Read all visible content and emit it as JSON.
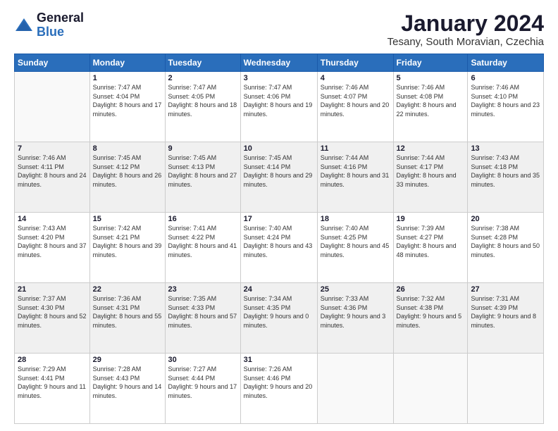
{
  "logo": {
    "general": "General",
    "blue": "Blue"
  },
  "title": "January 2024",
  "location": "Tesany, South Moravian, Czechia",
  "weekdays": [
    "Sunday",
    "Monday",
    "Tuesday",
    "Wednesday",
    "Thursday",
    "Friday",
    "Saturday"
  ],
  "weeks": [
    [
      {
        "day": "",
        "sunrise": "",
        "sunset": "",
        "daylight": ""
      },
      {
        "day": "1",
        "sunrise": "Sunrise: 7:47 AM",
        "sunset": "Sunset: 4:04 PM",
        "daylight": "Daylight: 8 hours and 17 minutes."
      },
      {
        "day": "2",
        "sunrise": "Sunrise: 7:47 AM",
        "sunset": "Sunset: 4:05 PM",
        "daylight": "Daylight: 8 hours and 18 minutes."
      },
      {
        "day": "3",
        "sunrise": "Sunrise: 7:47 AM",
        "sunset": "Sunset: 4:06 PM",
        "daylight": "Daylight: 8 hours and 19 minutes."
      },
      {
        "day": "4",
        "sunrise": "Sunrise: 7:46 AM",
        "sunset": "Sunset: 4:07 PM",
        "daylight": "Daylight: 8 hours and 20 minutes."
      },
      {
        "day": "5",
        "sunrise": "Sunrise: 7:46 AM",
        "sunset": "Sunset: 4:08 PM",
        "daylight": "Daylight: 8 hours and 22 minutes."
      },
      {
        "day": "6",
        "sunrise": "Sunrise: 7:46 AM",
        "sunset": "Sunset: 4:10 PM",
        "daylight": "Daylight: 8 hours and 23 minutes."
      }
    ],
    [
      {
        "day": "7",
        "sunrise": "Sunrise: 7:46 AM",
        "sunset": "Sunset: 4:11 PM",
        "daylight": "Daylight: 8 hours and 24 minutes."
      },
      {
        "day": "8",
        "sunrise": "Sunrise: 7:45 AM",
        "sunset": "Sunset: 4:12 PM",
        "daylight": "Daylight: 8 hours and 26 minutes."
      },
      {
        "day": "9",
        "sunrise": "Sunrise: 7:45 AM",
        "sunset": "Sunset: 4:13 PM",
        "daylight": "Daylight: 8 hours and 27 minutes."
      },
      {
        "day": "10",
        "sunrise": "Sunrise: 7:45 AM",
        "sunset": "Sunset: 4:14 PM",
        "daylight": "Daylight: 8 hours and 29 minutes."
      },
      {
        "day": "11",
        "sunrise": "Sunrise: 7:44 AM",
        "sunset": "Sunset: 4:16 PM",
        "daylight": "Daylight: 8 hours and 31 minutes."
      },
      {
        "day": "12",
        "sunrise": "Sunrise: 7:44 AM",
        "sunset": "Sunset: 4:17 PM",
        "daylight": "Daylight: 8 hours and 33 minutes."
      },
      {
        "day": "13",
        "sunrise": "Sunrise: 7:43 AM",
        "sunset": "Sunset: 4:18 PM",
        "daylight": "Daylight: 8 hours and 35 minutes."
      }
    ],
    [
      {
        "day": "14",
        "sunrise": "Sunrise: 7:43 AM",
        "sunset": "Sunset: 4:20 PM",
        "daylight": "Daylight: 8 hours and 37 minutes."
      },
      {
        "day": "15",
        "sunrise": "Sunrise: 7:42 AM",
        "sunset": "Sunset: 4:21 PM",
        "daylight": "Daylight: 8 hours and 39 minutes."
      },
      {
        "day": "16",
        "sunrise": "Sunrise: 7:41 AM",
        "sunset": "Sunset: 4:22 PM",
        "daylight": "Daylight: 8 hours and 41 minutes."
      },
      {
        "day": "17",
        "sunrise": "Sunrise: 7:40 AM",
        "sunset": "Sunset: 4:24 PM",
        "daylight": "Daylight: 8 hours and 43 minutes."
      },
      {
        "day": "18",
        "sunrise": "Sunrise: 7:40 AM",
        "sunset": "Sunset: 4:25 PM",
        "daylight": "Daylight: 8 hours and 45 minutes."
      },
      {
        "day": "19",
        "sunrise": "Sunrise: 7:39 AM",
        "sunset": "Sunset: 4:27 PM",
        "daylight": "Daylight: 8 hours and 48 minutes."
      },
      {
        "day": "20",
        "sunrise": "Sunrise: 7:38 AM",
        "sunset": "Sunset: 4:28 PM",
        "daylight": "Daylight: 8 hours and 50 minutes."
      }
    ],
    [
      {
        "day": "21",
        "sunrise": "Sunrise: 7:37 AM",
        "sunset": "Sunset: 4:30 PM",
        "daylight": "Daylight: 8 hours and 52 minutes."
      },
      {
        "day": "22",
        "sunrise": "Sunrise: 7:36 AM",
        "sunset": "Sunset: 4:31 PM",
        "daylight": "Daylight: 8 hours and 55 minutes."
      },
      {
        "day": "23",
        "sunrise": "Sunrise: 7:35 AM",
        "sunset": "Sunset: 4:33 PM",
        "daylight": "Daylight: 8 hours and 57 minutes."
      },
      {
        "day": "24",
        "sunrise": "Sunrise: 7:34 AM",
        "sunset": "Sunset: 4:35 PM",
        "daylight": "Daylight: 9 hours and 0 minutes."
      },
      {
        "day": "25",
        "sunrise": "Sunrise: 7:33 AM",
        "sunset": "Sunset: 4:36 PM",
        "daylight": "Daylight: 9 hours and 3 minutes."
      },
      {
        "day": "26",
        "sunrise": "Sunrise: 7:32 AM",
        "sunset": "Sunset: 4:38 PM",
        "daylight": "Daylight: 9 hours and 5 minutes."
      },
      {
        "day": "27",
        "sunrise": "Sunrise: 7:31 AM",
        "sunset": "Sunset: 4:39 PM",
        "daylight": "Daylight: 9 hours and 8 minutes."
      }
    ],
    [
      {
        "day": "28",
        "sunrise": "Sunrise: 7:29 AM",
        "sunset": "Sunset: 4:41 PM",
        "daylight": "Daylight: 9 hours and 11 minutes."
      },
      {
        "day": "29",
        "sunrise": "Sunrise: 7:28 AM",
        "sunset": "Sunset: 4:43 PM",
        "daylight": "Daylight: 9 hours and 14 minutes."
      },
      {
        "day": "30",
        "sunrise": "Sunrise: 7:27 AM",
        "sunset": "Sunset: 4:44 PM",
        "daylight": "Daylight: 9 hours and 17 minutes."
      },
      {
        "day": "31",
        "sunrise": "Sunrise: 7:26 AM",
        "sunset": "Sunset: 4:46 PM",
        "daylight": "Daylight: 9 hours and 20 minutes."
      },
      {
        "day": "",
        "sunrise": "",
        "sunset": "",
        "daylight": ""
      },
      {
        "day": "",
        "sunrise": "",
        "sunset": "",
        "daylight": ""
      },
      {
        "day": "",
        "sunrise": "",
        "sunset": "",
        "daylight": ""
      }
    ]
  ]
}
